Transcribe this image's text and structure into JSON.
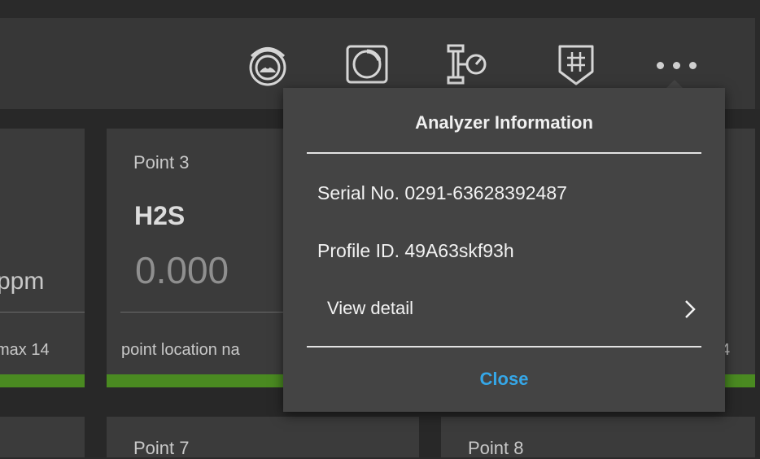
{
  "toolbar": {
    "icons": [
      "gauge-icon",
      "dial-icon",
      "flow-meter-icon",
      "shield-grid-icon",
      "more-icon"
    ]
  },
  "cards": {
    "left_partial": {
      "unit": "ppm",
      "footer": "max 14"
    },
    "point3": {
      "title": "Point 3",
      "gas": "H2S",
      "value": "0.000",
      "footer": "point location na"
    },
    "right_partial": {
      "footer": "4"
    },
    "point7": {
      "title": "Point 7"
    },
    "point8": {
      "title": "Point 8"
    }
  },
  "popover": {
    "title": "Analyzer Information",
    "serial": "Serial No. 0291-63628392487",
    "profile": "Profile ID. 49A63skf93h",
    "view_detail": "View detail",
    "close": "Close"
  },
  "colors": {
    "status_ok": "#4a8a21",
    "link": "#35a7e8"
  }
}
